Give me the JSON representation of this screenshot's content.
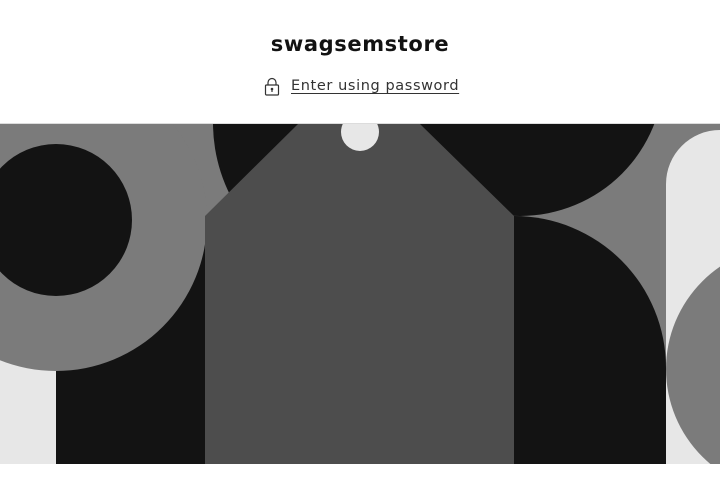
{
  "header": {
    "store_name": "swagsemstore",
    "password_link": {
      "label": "Enter using password",
      "icon": "padlock-icon"
    }
  },
  "banner": {
    "type": "decorative-illustration",
    "palette": {
      "light": "#e7e7e7",
      "mid": "#7b7b7b",
      "dark": "#4d4d4d",
      "black": "#131313"
    }
  }
}
